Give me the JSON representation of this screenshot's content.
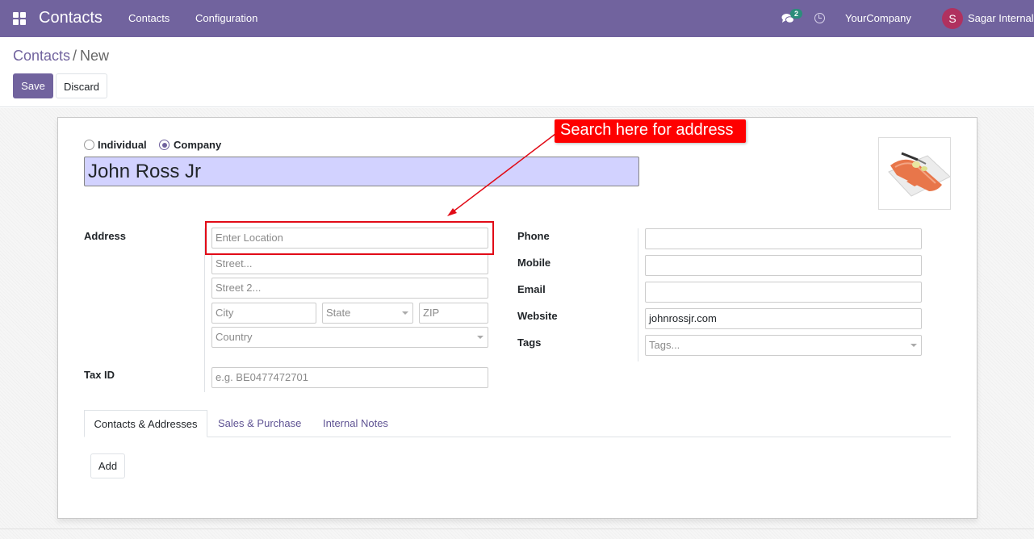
{
  "navbar": {
    "app_name": "Contacts",
    "menu": [
      "Contacts",
      "Configuration"
    ],
    "messages_count": "2",
    "company": "YourCompany",
    "user_initial": "S",
    "user_name": "Sagar Internal",
    "colors": {
      "primary": "#71639e",
      "avatar": "#b0315f",
      "badge": "#2c8d7b"
    },
    "icons": [
      "apps-grid-icon",
      "chat-icon",
      "clock-icon"
    ]
  },
  "breadcrumb": {
    "parent": "Contacts",
    "separator": "/",
    "current": "New"
  },
  "actions": {
    "save": "Save",
    "discard": "Discard"
  },
  "form": {
    "type_options": {
      "individual": "Individual",
      "company": "Company"
    },
    "selected_type": "company",
    "name": "John Ross Jr",
    "labels": {
      "address": "Address",
      "tax_id": "Tax ID",
      "phone": "Phone",
      "mobile": "Mobile",
      "email": "Email",
      "website": "Website",
      "tags": "Tags"
    },
    "placeholders": {
      "location": "Enter Location",
      "street": "Street...",
      "street2": "Street 2...",
      "city": "City",
      "state": "State",
      "zip": "ZIP",
      "country": "Country",
      "tax_id": "e.g. BE0477472701",
      "tags": "Tags..."
    },
    "values": {
      "phone": "",
      "mobile": "",
      "email": "",
      "website": "johnrossjr.com"
    }
  },
  "annotation": {
    "callout": "Search here for address",
    "color": "#fe0000"
  },
  "tabs": [
    "Contacts & Addresses",
    "Sales & Purchase",
    "Internal Notes"
  ],
  "active_tab": 0,
  "add_button": "Add"
}
